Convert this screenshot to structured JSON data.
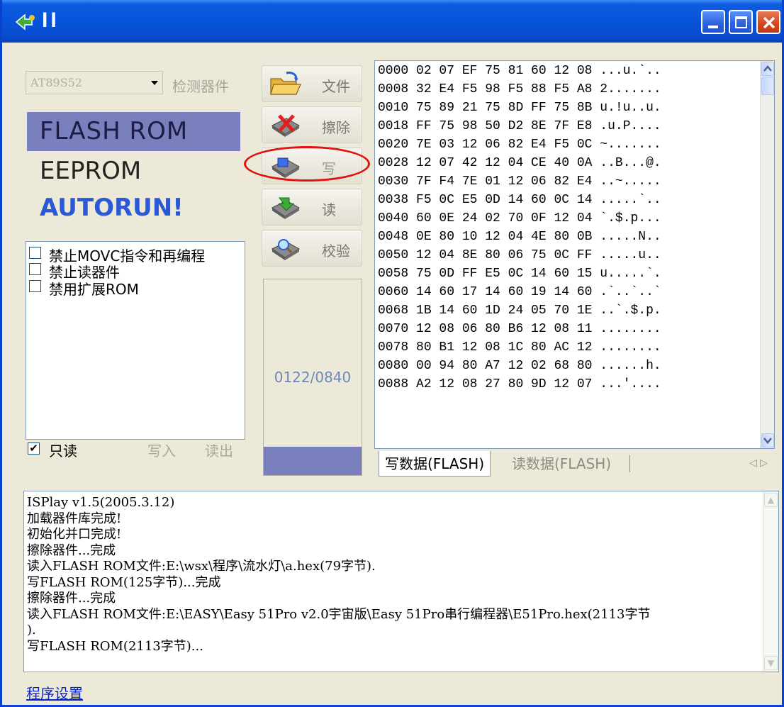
{
  "window": {
    "title": "II",
    "icon": "app-arrow-icon",
    "buttons": [
      "minimize-icon",
      "maximize-icon",
      "close-icon"
    ]
  },
  "device": {
    "selected": "AT89S52",
    "detect_label": "检测器件"
  },
  "rom_targets": {
    "flash": "FLASH ROM",
    "eeprom": "EEPROM",
    "autorun": "AUTORUN!"
  },
  "options": [
    {
      "label": "禁止MOVC指令和再编程",
      "checked": false
    },
    {
      "label": "禁止读器件",
      "checked": false
    },
    {
      "label": "禁用扩展ROM",
      "checked": false
    }
  ],
  "readonly": {
    "label": "只读",
    "checked": true,
    "mark": "✔"
  },
  "write_link": "写入",
  "read_link": "读出",
  "actions": [
    {
      "label": "文件",
      "icon": "folder-open-icon"
    },
    {
      "label": "擦除",
      "icon": "chip-erase-icon"
    },
    {
      "label": "写",
      "icon": "chip-write-icon"
    },
    {
      "label": "读",
      "icon": "chip-read-icon"
    },
    {
      "label": "校验",
      "icon": "chip-verify-icon"
    }
  ],
  "progress": {
    "text": "0122/0840",
    "fraction": 0.145
  },
  "hex": [
    {
      "addr": "0000",
      "bytes": "02 07 EF 75 81 60 12 08",
      "ascii": "...u.`.."
    },
    {
      "addr": "0008",
      "bytes": "32 E4 F5 98 F5 88 F5 A8",
      "ascii": "2......."
    },
    {
      "addr": "0010",
      "bytes": "75 89 21 75 8D FF 75 8B",
      "ascii": "u.!u..u."
    },
    {
      "addr": "0018",
      "bytes": "FF 75 98 50 D2 8E 7F E8",
      "ascii": ".u.P...."
    },
    {
      "addr": "0020",
      "bytes": "7E 03 12 06 82 E4 F5 0C",
      "ascii": "~......."
    },
    {
      "addr": "0028",
      "bytes": "12 07 42 12 04 CE 40 0A",
      "ascii": "..B...@."
    },
    {
      "addr": "0030",
      "bytes": "7F F4 7E 01 12 06 82 E4",
      "ascii": "..~....."
    },
    {
      "addr": "0038",
      "bytes": "F5 0C E5 0D 14 60 0C 14",
      "ascii": ".....`.."
    },
    {
      "addr": "0040",
      "bytes": "60 0E 24 02 70 0F 12 04",
      "ascii": "`.$.p..."
    },
    {
      "addr": "0048",
      "bytes": "0E 80 10 12 04 4E 80 0B",
      "ascii": ".....N.."
    },
    {
      "addr": "0050",
      "bytes": "12 04 8E 80 06 75 0C FF",
      "ascii": ".....u.."
    },
    {
      "addr": "0058",
      "bytes": "75 0D FF E5 0C 14 60 15",
      "ascii": "u.....`."
    },
    {
      "addr": "0060",
      "bytes": "14 60 17 14 60 19 14 60",
      "ascii": ".`..`..`"
    },
    {
      "addr": "0068",
      "bytes": "1B 14 60 1D 24 05 70 1E",
      "ascii": "..`.$.p."
    },
    {
      "addr": "0070",
      "bytes": "12 08 06 80 B6 12 08 11",
      "ascii": "........"
    },
    {
      "addr": "0078",
      "bytes": "80 B1 12 08 1C 80 AC 12",
      "ascii": "........"
    },
    {
      "addr": "0080",
      "bytes": "00 94 80 A7 12 02 68 80",
      "ascii": "......h."
    },
    {
      "addr": "0088",
      "bytes": "A2 12 08 27 80 9D 12 07",
      "ascii": "...'...."
    }
  ],
  "tabs": [
    "写数据(FLASH)",
    "读数据(FLASH)"
  ],
  "log": [
    "ISPlay v1.5(2005.3.12)",
    "加载器件库完成!",
    "初始化并口完成!",
    "擦除器件...完成",
    "读入FLASH ROM文件:E:\\wsx\\程序\\流水灯\\a.hex(79字节).",
    "写FLASH ROM(125字节)...完成",
    "擦除器件...完成",
    "读入FLASH ROM文件:E:\\EASY\\Easy 51Pro v2.0宇宙版\\Easy 51Pro串行编程器\\E51Pro.hex(2113字节",
    ").",
    "写FLASH ROM(2113字节)..."
  ],
  "settings_link": "程序设置",
  "colors": {
    "titlebar": "#0654d9",
    "selected_rom": "#7a7fbe",
    "autorun": "#2a58d6",
    "annotation_oval": "#e01212",
    "link": "#0a24c8"
  }
}
